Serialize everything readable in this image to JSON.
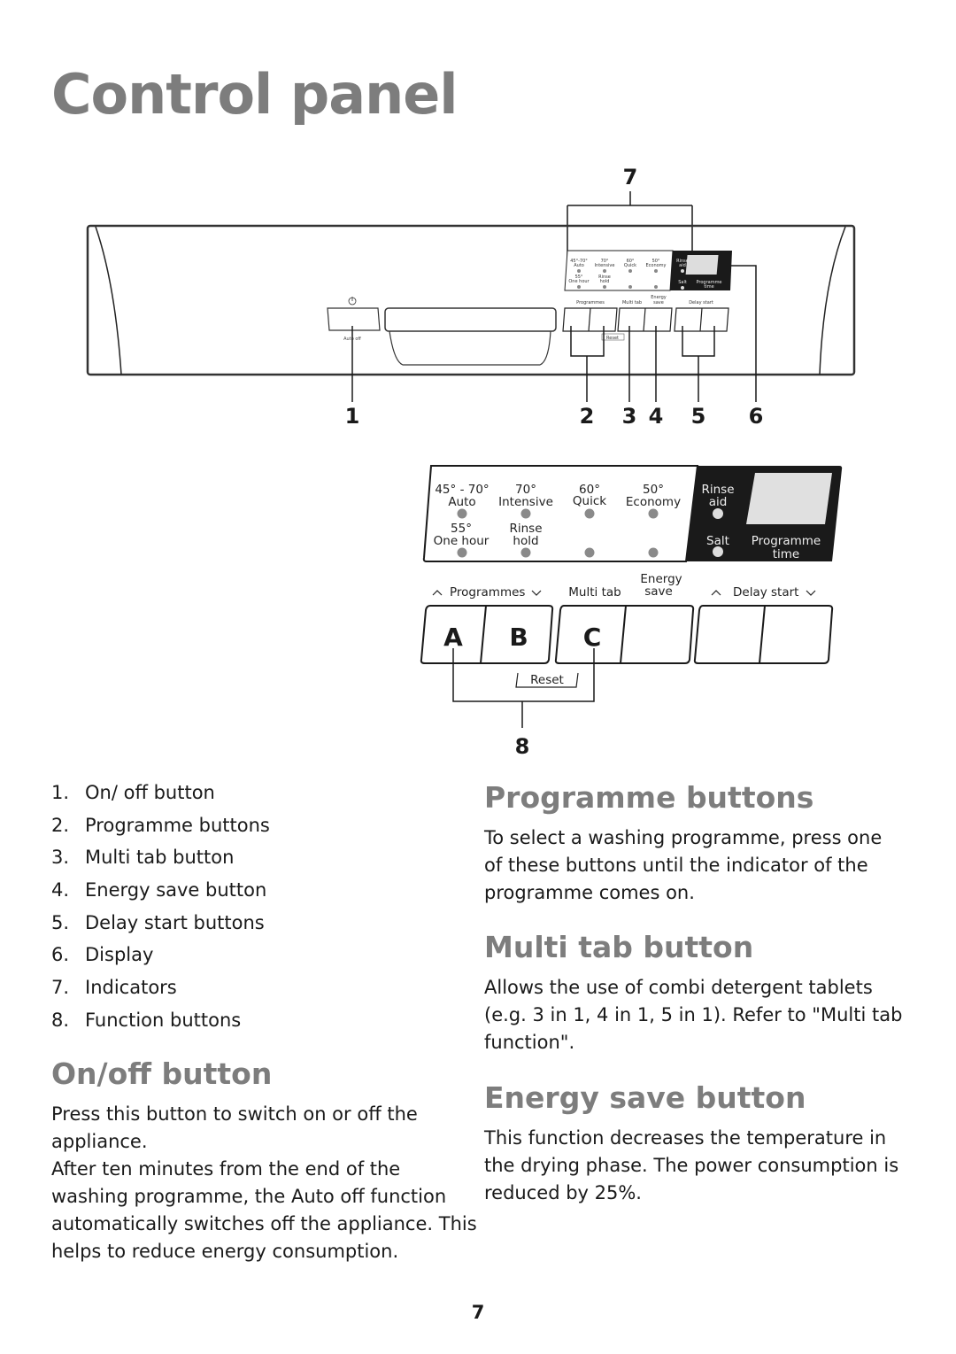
{
  "page": {
    "title": "Control panel",
    "page_number": "7"
  },
  "overview_diagram": {
    "callouts": [
      "1",
      "2",
      "3",
      "4",
      "5",
      "6",
      "7"
    ],
    "power_symbol": "power-icon",
    "auto_off_label": "Auto off",
    "reset_label": "Reset",
    "indicator_labels": [
      [
        "45° - 70°",
        "Auto"
      ],
      [
        "70°",
        "Intensive"
      ],
      [
        "60°",
        "Quick"
      ],
      [
        "50°",
        "Economy"
      ],
      [
        "55°",
        "One hour"
      ],
      [
        "Rinse",
        "hold"
      ]
    ],
    "dark_labels": [
      "Rinse aid",
      "Salt",
      "Programme time"
    ],
    "button_labels": {
      "programmes": "Programmes",
      "multi_tab": "Multi tab",
      "energy_save_1": "Energy",
      "energy_save_2": "save",
      "delay_start": "Delay start"
    }
  },
  "detail_diagram": {
    "indicators_top": [
      {
        "line1": "45° - 70°",
        "line2": "Auto"
      },
      {
        "line1": "70°",
        "line2": "Intensive"
      },
      {
        "line1": "60°",
        "line2": "Quick"
      },
      {
        "line1": "50°",
        "line2": "Economy"
      }
    ],
    "indicators_bottom": [
      {
        "line1": "55°",
        "line2": "One hour"
      },
      {
        "line1": "Rinse",
        "line2": "hold"
      },
      {
        "line1": "",
        "line2": ""
      },
      {
        "line1": "",
        "line2": ""
      }
    ],
    "rinse_aid": {
      "line1": "Rinse",
      "line2": "aid"
    },
    "salt": "Salt",
    "programme_time": {
      "line1": "Programme",
      "line2": "time"
    },
    "programmes_label": "Programmes",
    "multi_tab_label": "Multi tab",
    "energy_save_line1": "Energy",
    "energy_save_line2": "save",
    "delay_start_label": "Delay start",
    "function_letters": [
      "A",
      "B",
      "C"
    ],
    "reset_label": "Reset",
    "callout": "8"
  },
  "legend": [
    {
      "num": "1.",
      "label": "On/ off button"
    },
    {
      "num": "2.",
      "label": "Programme buttons"
    },
    {
      "num": "3.",
      "label": "Multi tab button"
    },
    {
      "num": "4.",
      "label": "Energy save button"
    },
    {
      "num": "5.",
      "label": "Delay start buttons"
    },
    {
      "num": "6.",
      "label": "Display"
    },
    {
      "num": "7.",
      "label": "Indicators"
    },
    {
      "num": "8.",
      "label": "Function buttons"
    }
  ],
  "sections": {
    "onoff": {
      "heading": "On/off button",
      "lines": [
        "Press this button to switch on or off the",
        "appliance.",
        "After ten minutes from the end of the",
        "washing programme, the Auto off function",
        "automatically switches off the appliance. This",
        "helps to reduce energy consumption."
      ]
    },
    "programme": {
      "heading": "Programme buttons",
      "lines": [
        "To select a washing programme, press one",
        "of these buttons until the indicator of the",
        "programme comes on."
      ]
    },
    "multitab": {
      "heading": "Multi tab button",
      "lines": [
        "Allows the use of combi detergent tablets",
        "(e.g. 3 in 1, 4 in 1, 5 in 1). Refer to \"Multi tab",
        "function\"."
      ]
    },
    "energy": {
      "heading": "Energy save button",
      "lines": [
        "This function decreases the temperature in",
        "the drying phase. The power consumption is",
        "reduced by 25%."
      ]
    }
  }
}
